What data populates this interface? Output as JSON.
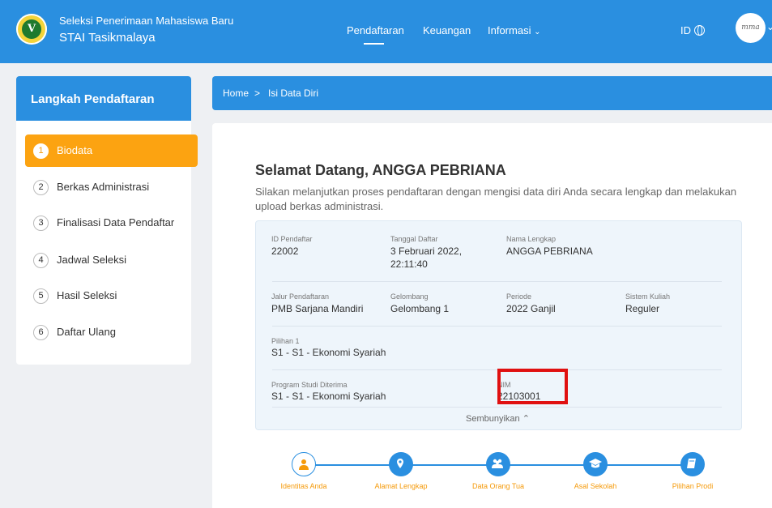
{
  "header": {
    "subtitle": "Seleksi Penerimaan Mahasiswa Baru",
    "title": "STAI Tasikmalaya",
    "nav": [
      "Pendaftaran",
      "Keuangan",
      "Informasi"
    ],
    "language": "ID",
    "avatar_text": "mma"
  },
  "sidebar": {
    "title": "Langkah Pendaftaran",
    "items": [
      {
        "num": "1",
        "label": "Biodata"
      },
      {
        "num": "2",
        "label": "Berkas Administrasi"
      },
      {
        "num": "3",
        "label": "Finalisasi Data Pendaftar"
      },
      {
        "num": "4",
        "label": "Jadwal Seleksi"
      },
      {
        "num": "5",
        "label": "Hasil Seleksi"
      },
      {
        "num": "6",
        "label": "Daftar Ulang"
      }
    ]
  },
  "breadcrumb": {
    "home": "Home",
    "sep": ">",
    "current": "Isi Data Diri"
  },
  "main": {
    "welcome": "Selamat Datang, ANGGA PEBRIANA",
    "intro": "Silakan melanjutkan proses pendaftaran dengan mengisi data diri Anda secara lengkap dan melakukan upload berkas administrasi.",
    "fields": {
      "id_label": "ID Pendaftar",
      "id_value": "22002",
      "tanggal_label": "Tanggal Daftar",
      "tanggal_value": "3 Februari 2022, 22:11:40",
      "nama_label": "Nama Lengkap",
      "nama_value": "ANGGA PEBRIANA",
      "jalur_label": "Jalur Pendaftaran",
      "jalur_value": "PMB Sarjana Mandiri",
      "gelombang_label": "Gelombang",
      "gelombang_value": "Gelombang 1",
      "periode_label": "Periode",
      "periode_value": "2022 Ganjil",
      "sistem_label": "Sistem Kuliah",
      "sistem_value": "Reguler",
      "pilihan_label": "Pilihan 1",
      "pilihan_value": "S1 - S1 - Ekonomi Syariah",
      "prodi_label": "Program Studi Diterima",
      "prodi_value": "S1 - S1 - Ekonomi Syariah",
      "nim_label": "NIM",
      "nim_value": "22103001"
    },
    "toggle": "Sembunyikan ⌃"
  },
  "steps": [
    {
      "label": "Identitas Anda",
      "icon": "person-icon"
    },
    {
      "label": "Alamat Lengkap",
      "icon": "location-pin-icon"
    },
    {
      "label": "Data Orang Tua",
      "icon": "users-icon"
    },
    {
      "label": "Asal Sekolah",
      "icon": "graduation-cap-icon"
    },
    {
      "label": "Pilihan Prodi",
      "icon": "book-icon"
    }
  ],
  "colors": {
    "primary": "#2a8fe0",
    "accent": "#fca311",
    "highlight": "#e01010"
  }
}
